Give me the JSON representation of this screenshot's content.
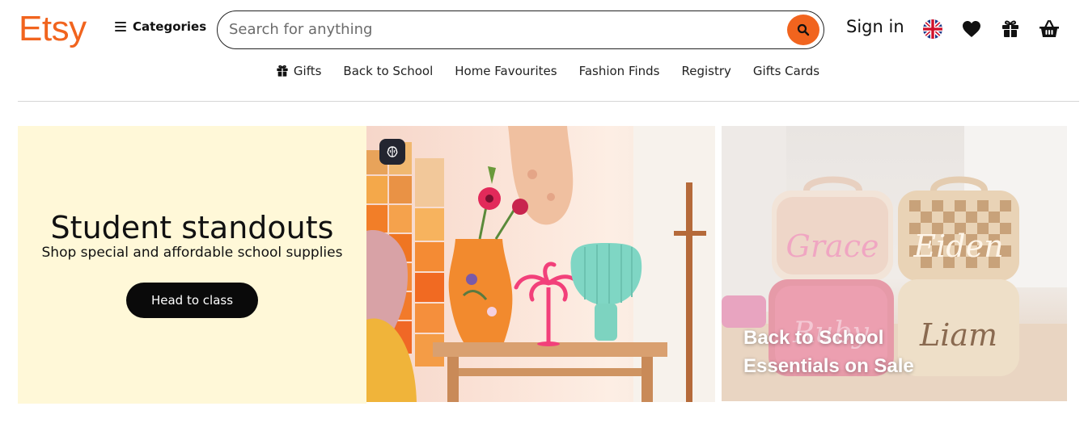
{
  "header": {
    "logo": "Etsy",
    "categories_label": "Categories",
    "search": {
      "placeholder": "Search for anything",
      "value": ""
    },
    "sign_in_label": "Sign in",
    "icons": [
      "uk-flag-icon",
      "heart-icon",
      "gift-icon",
      "basket-icon"
    ]
  },
  "nav": {
    "items": [
      {
        "label": "Gifts",
        "icon": "gift-icon"
      },
      {
        "label": "Back to School"
      },
      {
        "label": "Home Favourites"
      },
      {
        "label": "Fashion Finds"
      },
      {
        "label": "Registry"
      },
      {
        "label": "Gifts Cards"
      }
    ]
  },
  "hero": {
    "title": "Student standouts",
    "subtitle": "Shop special and affordable school supplies",
    "button_label": "Head to class",
    "background_color": "#FFF8D8"
  },
  "promo": {
    "line1": "Back to School",
    "line2": "Essentials on Sale",
    "bag_names": [
      "Grace",
      "Eiden",
      "Ruby",
      "Liam"
    ]
  },
  "colors": {
    "brand": "#F1641E",
    "button_dark": "#0a0a0a"
  }
}
